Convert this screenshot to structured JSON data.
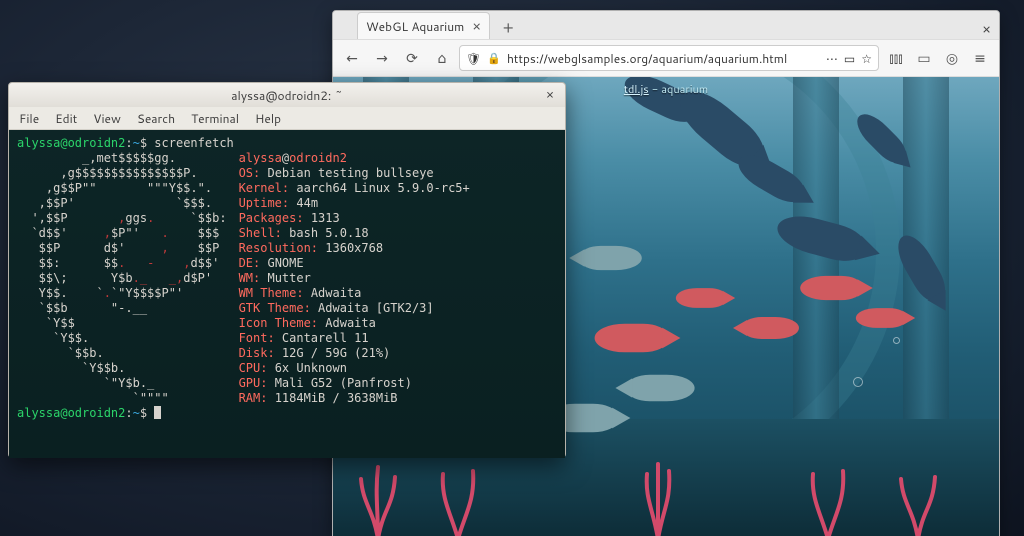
{
  "browser": {
    "tab_title": "WebGL Aquarium",
    "url": "https://webglsamples.org/aquarium/aquarium.html",
    "overlay_link": "tdl.js",
    "overlay_text": " - aquarium"
  },
  "terminal": {
    "title": "alyssa@odroidn2: ~",
    "menu": [
      "File",
      "Edit",
      "View",
      "Search",
      "Terminal",
      "Help"
    ],
    "prompt_user": "alyssa@odroidn2",
    "prompt_path": "~",
    "command": "screenfetch",
    "ascii": [
      "         _,met$$$$$gg.",
      "      ,g$$$$$$$$$$$$$$$P.",
      "    ,g$$P\"\"       \"\"\"Y$$.\".",
      "   ,$$P'              `$$$.",
      "  ',$$P       ,ggs.     `$$b:",
      "  `d$$'     ,$P\"'   .    $$$",
      "   $$P      d$'     ,    $$P",
      "   $$:      $$.   -    ,d$$'",
      "   $$\\;      Y$b._   _,d$P'",
      "   Y$$.    `.`\"Y$$$$P\"'",
      "   `$$b      \"-.__",
      "    `Y$$",
      "     `Y$$.",
      "       `$$b.",
      "         `Y$$b.",
      "            `\"Y$b._",
      "                `\"\"\"\""
    ],
    "info": [
      {
        "k": "",
        "v": "alyssa@odroidn2",
        "host": true
      },
      {
        "k": "OS:",
        "v": " Debian testing bullseye"
      },
      {
        "k": "Kernel:",
        "v": " aarch64 Linux 5.9.0-rc5+"
      },
      {
        "k": "Uptime:",
        "v": " 44m"
      },
      {
        "k": "Packages:",
        "v": " 1313"
      },
      {
        "k": "Shell:",
        "v": " bash 5.0.18"
      },
      {
        "k": "Resolution:",
        "v": " 1360x768"
      },
      {
        "k": "DE:",
        "v": " GNOME"
      },
      {
        "k": "WM:",
        "v": " Mutter"
      },
      {
        "k": "WM Theme:",
        "v": " Adwaita"
      },
      {
        "k": "GTK Theme:",
        "v": " Adwaita [GTK2/3]"
      },
      {
        "k": "Icon Theme:",
        "v": " Adwaita"
      },
      {
        "k": "Font:",
        "v": " Cantarell 11"
      },
      {
        "k": "Disk:",
        "v": " 12G / 59G (21%)"
      },
      {
        "k": "CPU:",
        "v": " 6x Unknown"
      },
      {
        "k": "GPU:",
        "v": " Mali G52 (Panfrost)"
      },
      {
        "k": "RAM:",
        "v": " 1184MiB / 3638MiB"
      }
    ]
  }
}
